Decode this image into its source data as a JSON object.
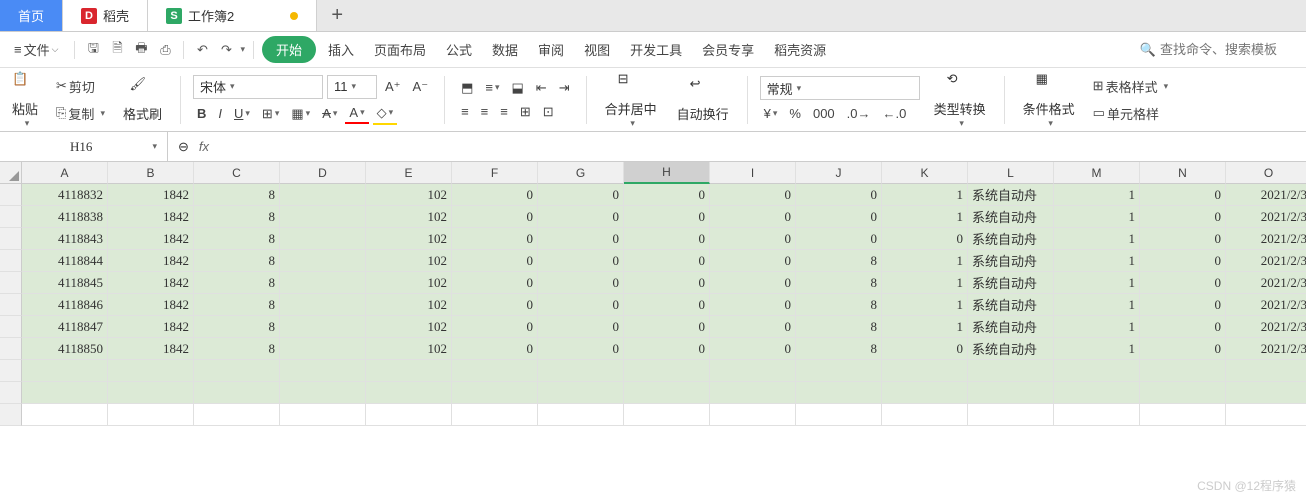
{
  "tabs": {
    "home": "首页",
    "docker": "稻壳",
    "workbook": "工作簿2"
  },
  "menubar": {
    "file": "文件",
    "start": "开始",
    "insert": "插入",
    "layout": "页面布局",
    "formula": "公式",
    "data": "数据",
    "review": "审阅",
    "view": "视图",
    "devtools": "开发工具",
    "member": "会员专享",
    "docker_res": "稻壳资源",
    "search_placeholder": "查找命令、搜索模板"
  },
  "ribbon": {
    "paste": "粘贴",
    "cut": "剪切",
    "copy": "复制",
    "format_painter": "格式刷",
    "font_name": "宋体",
    "font_size": "11",
    "merge_center": "合并居中",
    "auto_wrap": "自动换行",
    "number_format": "常规",
    "type_convert": "类型转换",
    "cond_format": "条件格式",
    "table_style": "表格样式",
    "cell_format": "单元格样"
  },
  "namebox": "H16",
  "columns": [
    "A",
    "B",
    "C",
    "D",
    "E",
    "F",
    "G",
    "H",
    "I",
    "J",
    "K",
    "L",
    "M",
    "N",
    "O"
  ],
  "selected_col": "H",
  "rows": [
    {
      "A": "4118832",
      "B": "1842",
      "C": "8",
      "D": "",
      "E": "102",
      "F": "0",
      "G": "0",
      "H": "0",
      "I": "0",
      "J": "0",
      "K": "1",
      "L": "系统自动舟",
      "M": "1",
      "N": "0",
      "O": "2021/2/3"
    },
    {
      "A": "4118838",
      "B": "1842",
      "C": "8",
      "D": "",
      "E": "102",
      "F": "0",
      "G": "0",
      "H": "0",
      "I": "0",
      "J": "0",
      "K": "1",
      "L": "系统自动舟",
      "M": "1",
      "N": "0",
      "O": "2021/2/3"
    },
    {
      "A": "4118843",
      "B": "1842",
      "C": "8",
      "D": "",
      "E": "102",
      "F": "0",
      "G": "0",
      "H": "0",
      "I": "0",
      "J": "0",
      "K": "0",
      "L": "系统自动舟",
      "M": "1",
      "N": "0",
      "O": "2021/2/3"
    },
    {
      "A": "4118844",
      "B": "1842",
      "C": "8",
      "D": "",
      "E": "102",
      "F": "0",
      "G": "0",
      "H": "0",
      "I": "0",
      "J": "8",
      "K": "1",
      "L": "系统自动舟",
      "M": "1",
      "N": "0",
      "O": "2021/2/3"
    },
    {
      "A": "4118845",
      "B": "1842",
      "C": "8",
      "D": "",
      "E": "102",
      "F": "0",
      "G": "0",
      "H": "0",
      "I": "0",
      "J": "8",
      "K": "1",
      "L": "系统自动舟",
      "M": "1",
      "N": "0",
      "O": "2021/2/3"
    },
    {
      "A": "4118846",
      "B": "1842",
      "C": "8",
      "D": "",
      "E": "102",
      "F": "0",
      "G": "0",
      "H": "0",
      "I": "0",
      "J": "8",
      "K": "1",
      "L": "系统自动舟",
      "M": "1",
      "N": "0",
      "O": "2021/2/3"
    },
    {
      "A": "4118847",
      "B": "1842",
      "C": "8",
      "D": "",
      "E": "102",
      "F": "0",
      "G": "0",
      "H": "0",
      "I": "0",
      "J": "8",
      "K": "1",
      "L": "系统自动舟",
      "M": "1",
      "N": "0",
      "O": "2021/2/3"
    },
    {
      "A": "4118850",
      "B": "1842",
      "C": "8",
      "D": "",
      "E": "102",
      "F": "0",
      "G": "0",
      "H": "0",
      "I": "0",
      "J": "8",
      "K": "0",
      "L": "系统自动舟",
      "M": "1",
      "N": "0",
      "O": "2021/2/3"
    }
  ],
  "blank_rows": 3,
  "watermark": "CSDN @12程序猿"
}
